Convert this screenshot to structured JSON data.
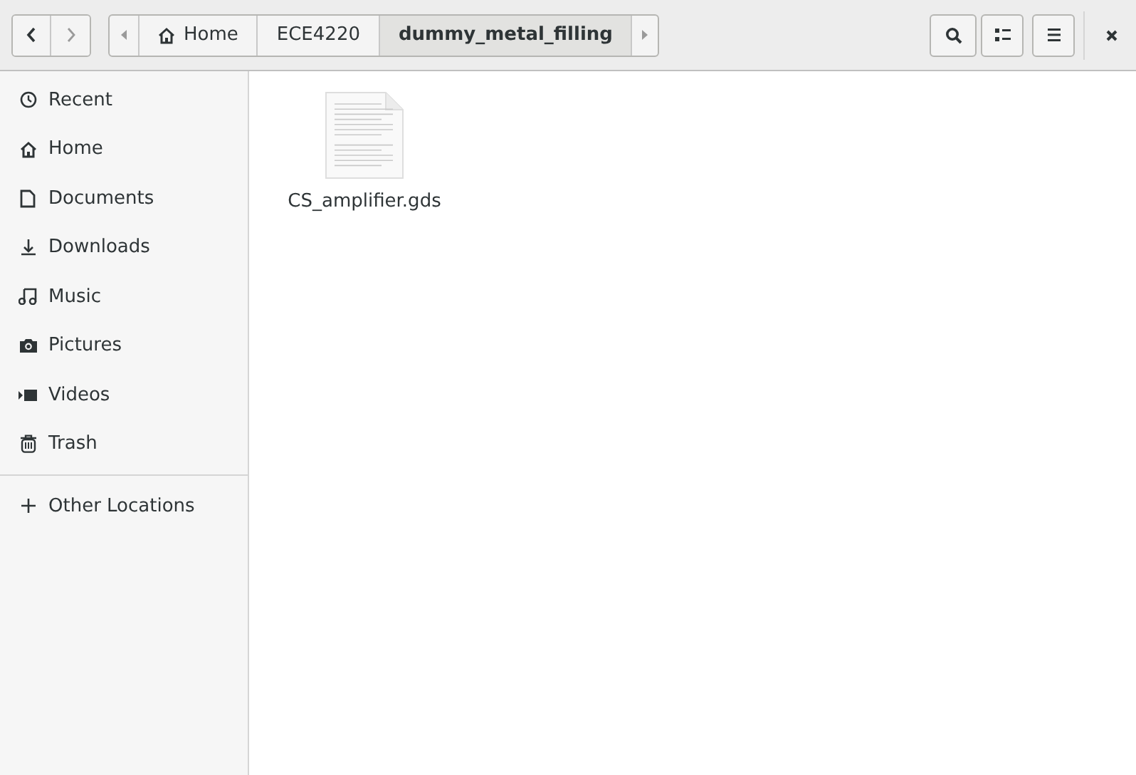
{
  "path_bar": [
    {
      "label": "Home",
      "kind": "home",
      "selected": false
    },
    {
      "label": "ECE4220",
      "kind": "folder",
      "selected": false
    },
    {
      "label": "dummy_metal_filling",
      "kind": "folder",
      "selected": true
    }
  ],
  "sidebar": {
    "items": [
      {
        "label": "Recent",
        "kind": "recent"
      },
      {
        "label": "Home",
        "kind": "home"
      },
      {
        "label": "Documents",
        "kind": "documents"
      },
      {
        "label": "Downloads",
        "kind": "downloads"
      },
      {
        "label": "Music",
        "kind": "music"
      },
      {
        "label": "Pictures",
        "kind": "pictures"
      },
      {
        "label": "Videos",
        "kind": "videos"
      },
      {
        "label": "Trash",
        "kind": "trash"
      }
    ],
    "other": {
      "label": "Other Locations"
    }
  },
  "files": [
    {
      "name": "CS_amplifier.gds"
    }
  ]
}
